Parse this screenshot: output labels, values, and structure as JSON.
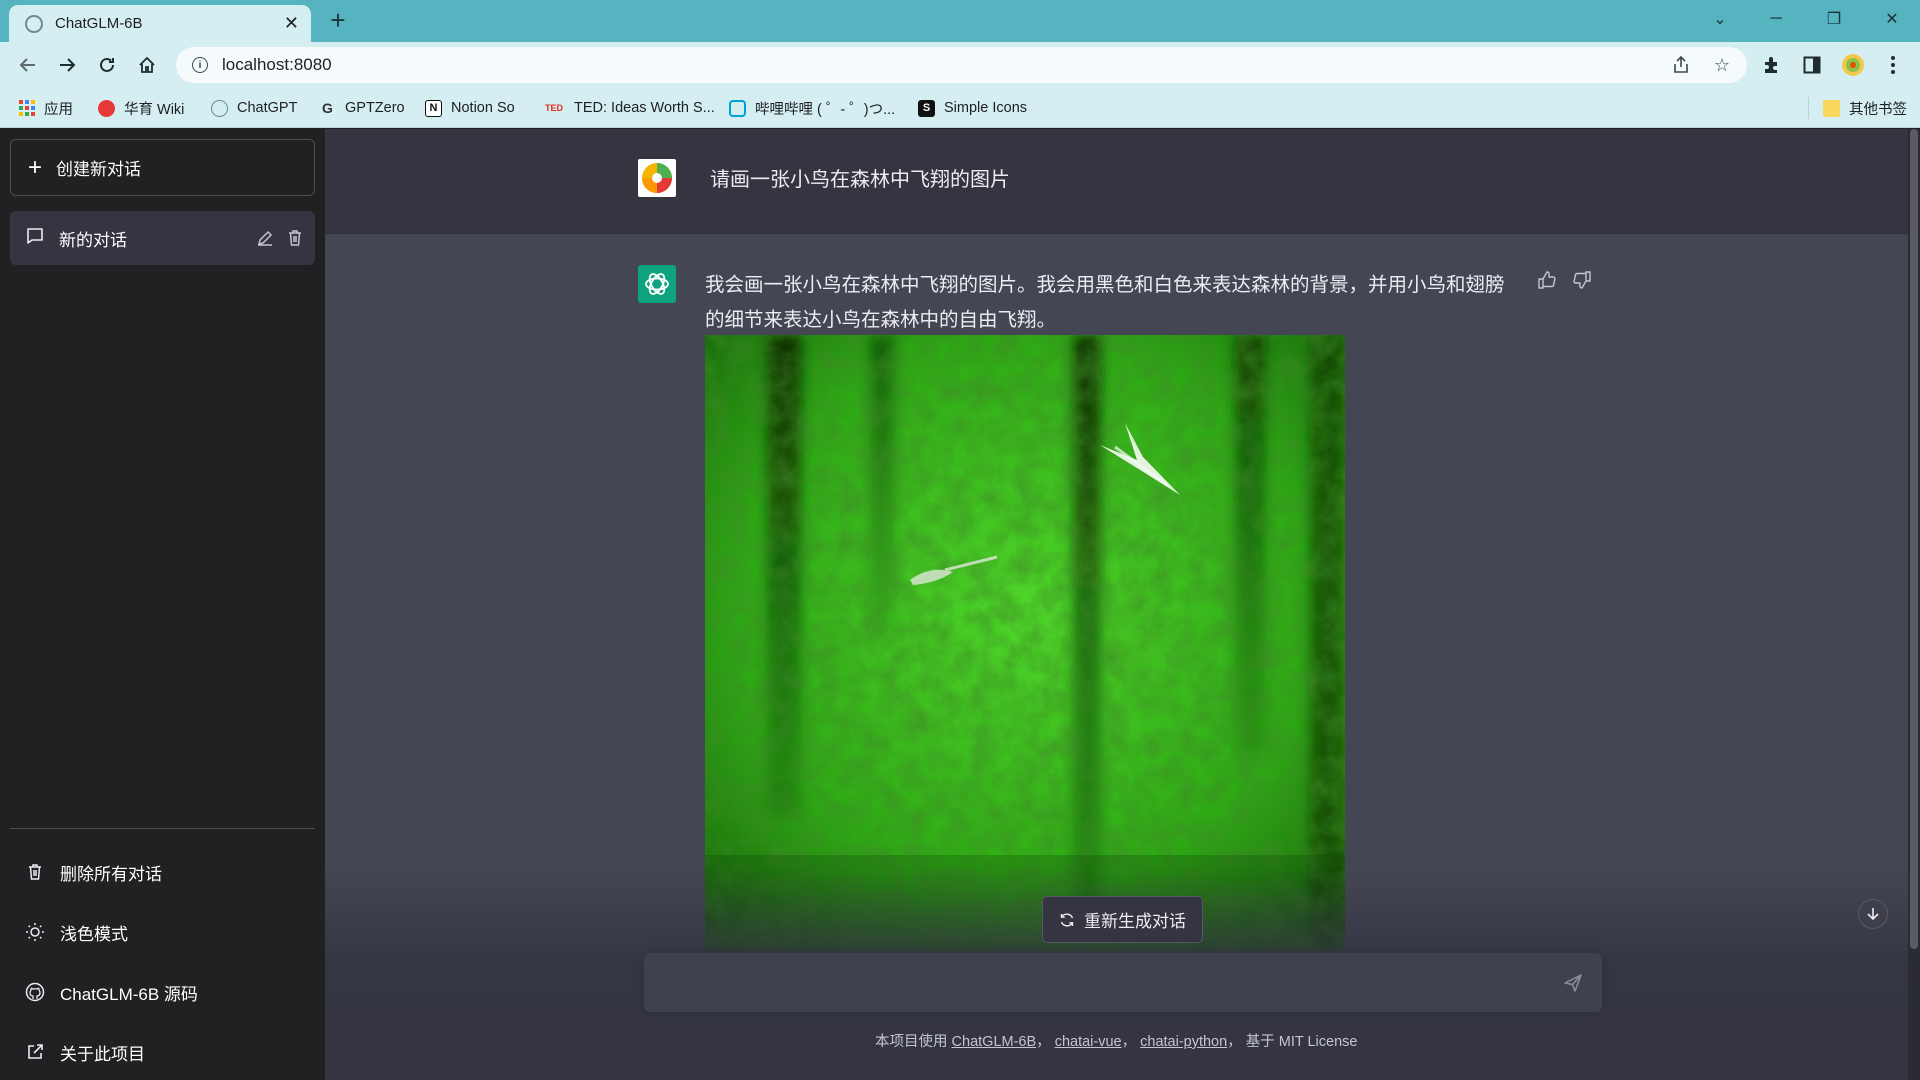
{
  "browser": {
    "tab_title": "ChatGLM-6B",
    "url": "localhost:8080",
    "bookmarks": [
      "应用",
      "华育 Wiki",
      "ChatGPT",
      "GPTZero",
      "Notion So",
      "TED: Ideas Worth S...",
      "哔哩哔哩 ( ゜- ゜)つ...",
      "Simple Icons"
    ],
    "other_bookmarks": "其他书签",
    "ted_badge": "TED",
    "notion_badge": "N",
    "simple_icons_badge": "S"
  },
  "sidebar": {
    "new_chat": "创建新对话",
    "conversation": "新的对话",
    "delete_all": "删除所有对话",
    "light_mode": "浅色模式",
    "source_code": "ChatGLM-6B 源码",
    "about": "关于此项目"
  },
  "chat": {
    "user_message": "请画一张小鸟在森林中飞翔的图片",
    "bot_message": "我会画一张小鸟在森林中飞翔的图片。我会用黑色和白色来表达森林的背景，并用小鸟和翅膀的细节来表达小鸟在森林中的自由飞翔。",
    "regenerate": "重新生成对话",
    "input_placeholder": ""
  },
  "footer": {
    "prefix": "本项目使用",
    "link1": "ChatGLM-6B",
    "link2": "chatai-vue",
    "link3": "chatai-python",
    "sep": "，",
    "suffix": "基于 MIT License"
  },
  "colors": {
    "sidebar_bg": "#202123",
    "main_bg": "#444654",
    "user_row_bg": "#343541",
    "accent": "#10a37f",
    "chrome_tabbar": "#56b4c0"
  }
}
